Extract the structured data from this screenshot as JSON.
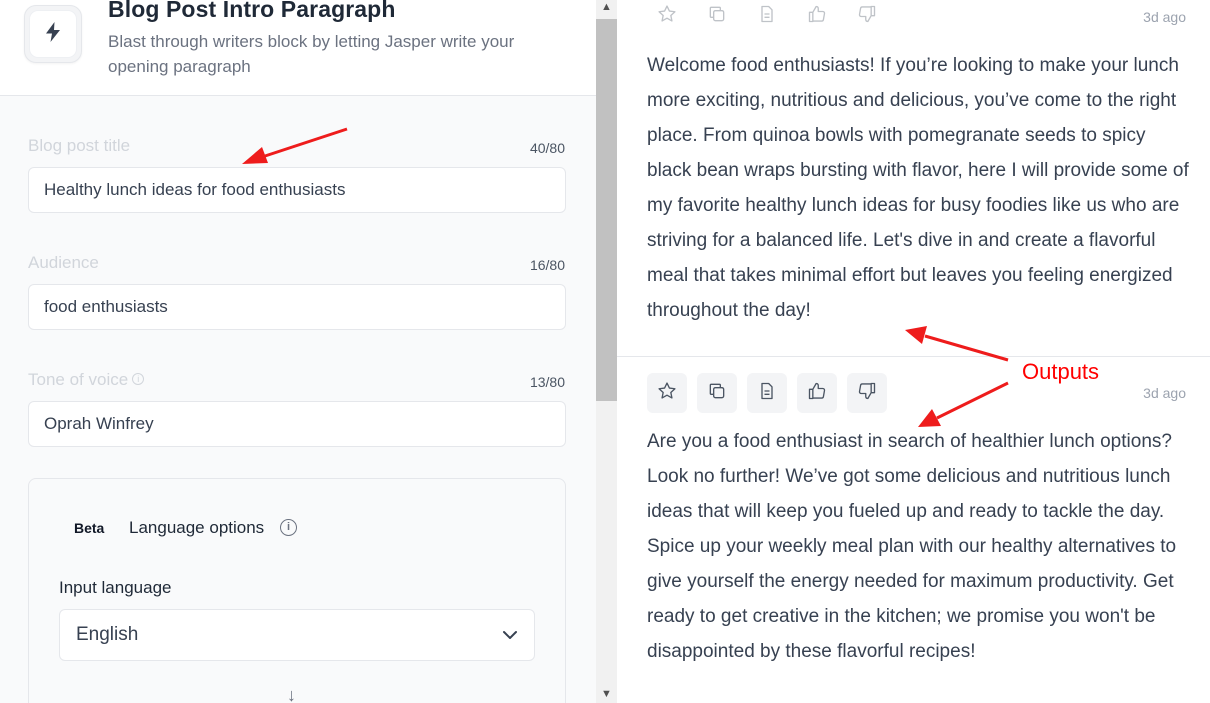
{
  "app": {
    "title": "Blog Post Intro Paragraph",
    "subtitle": "Blast through writers block by letting Jasper write your opening paragraph"
  },
  "form": {
    "fields": [
      {
        "label": "Blog post title",
        "count": "40/80",
        "value": "Healthy lunch ideas for food enthusiasts"
      },
      {
        "label": "Audience",
        "count": "16/80",
        "value": "food enthusiasts"
      },
      {
        "label": "Tone of voice",
        "count": "13/80",
        "value": "Oprah Winfrey"
      }
    ],
    "language": {
      "badge": "Beta",
      "title": "Language options",
      "input_label": "Input language",
      "selected": "English",
      "swap_glyph": "↓"
    }
  },
  "outputs": [
    {
      "time": "3d ago",
      "text": "Welcome food enthusiasts! If you’re looking to make your lunch more exciting, nutritious and delicious, you’ve come to the right place. From quinoa bowls with pomegranate seeds to spicy black bean wraps bursting with flavor, here I will provide some of my favorite healthy lunch ideas for busy foodies like us who are striving for a balanced life. Let's dive in and create a flavorful meal that takes minimal effort but leaves you feeling energized throughout the day!"
    },
    {
      "time": "3d ago",
      "text": "Are you a food enthusiast in search of healthier lunch options? Look no further! We’ve got some delicious and nutritious lunch ideas that will keep you fueled up and ready to tackle the day. Spice up your weekly meal plan with our healthy alternatives to give yourself the energy needed for maximum productivity. Get ready to get creative in the kitchen; we promise you won't be disappointed by these flavorful recipes!"
    }
  ],
  "annotation": {
    "label": "Outputs",
    "color": "#ff0000"
  },
  "icons": {
    "app": "bolt-icon",
    "actions": [
      "star-icon",
      "copy-icon",
      "document-icon",
      "thumbs-up-icon",
      "thumbs-down-icon"
    ]
  },
  "colors": {
    "text": "#374151",
    "muted": "#9ca3af",
    "border": "#e5e7eb",
    "panel_bg": "#f9fafb"
  }
}
